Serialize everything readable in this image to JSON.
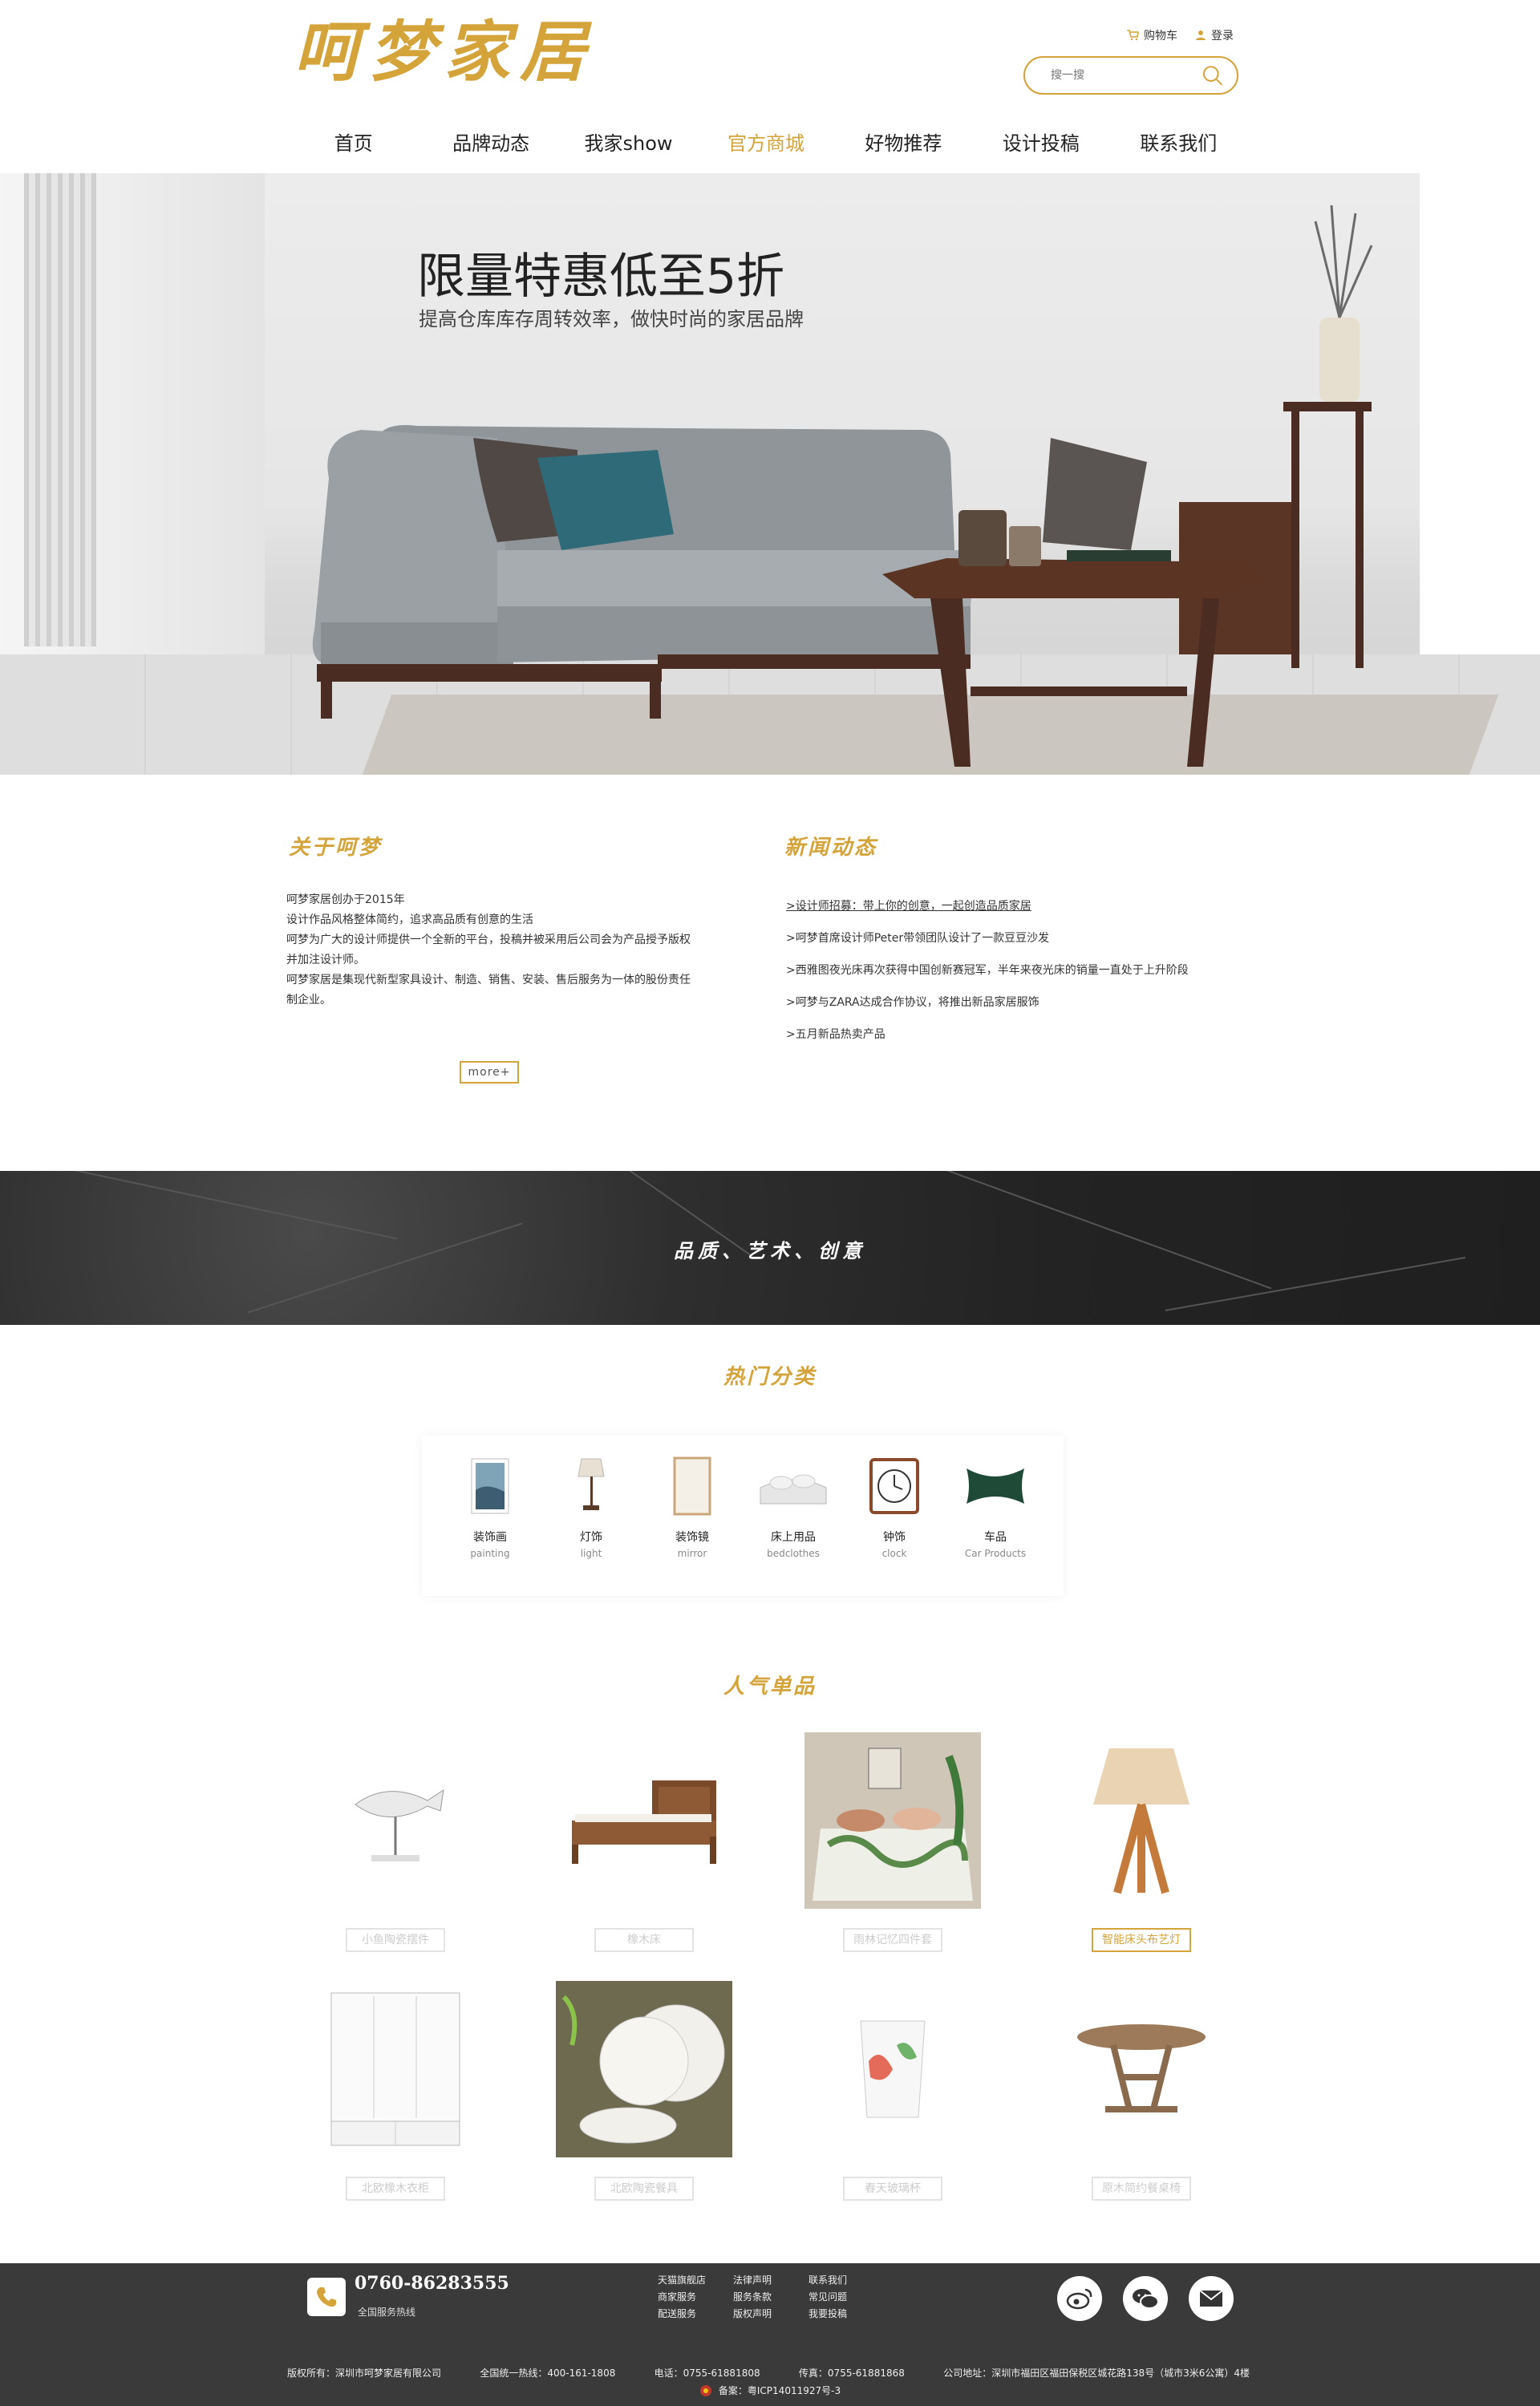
{
  "header": {
    "logo": "呵梦家居",
    "cart_label": "购物车",
    "login_label": "登录",
    "search_placeholder": "搜一搜",
    "accent_color": "#d4a33a"
  },
  "nav": {
    "items": [
      "首页",
      "品牌动态",
      "我家show",
      "官方商城",
      "好物推荐",
      "设计投稿",
      "联系我们"
    ],
    "active": "官方商城"
  },
  "banner": {
    "title": "限量特惠低至5折",
    "subtitle": "提高仓库库存周转效率，做快时尚的家居品牌"
  },
  "about": {
    "title": "关于呵梦",
    "lines": [
      "呵梦家居创办于2015年",
      "设计作品风格整体简约，追求高品质有创意的生活",
      "呵梦为广大的设计师提供一个全新的平台，投稿并被采用后公司会为产品授予版权",
      "并加注设计师。",
      "呵梦家居是集现代新型家具设计、制造、销售、安装、售后服务为一体的股份责任",
      "制企业。"
    ],
    "more": "more+"
  },
  "news": {
    "title": "新闻动态",
    "items": [
      ">设计师招募：带上你的创意，一起创造品质家居",
      ">呵梦首席设计师Peter带领团队设计了一款豆豆沙发",
      ">西雅图夜光床再次获得中国创新赛冠军，半年来夜光床的销量一直处于上升阶段",
      ">呵梦与ZARA达成合作协议，将推出新品家居服饰",
      ">五月新品热卖产品"
    ]
  },
  "band": {
    "text": "品质、艺术、创意"
  },
  "categories": {
    "title": "热门分类",
    "items": [
      {
        "zh": "装饰画",
        "en": "painting",
        "icon": "painting-icon"
      },
      {
        "zh": "灯饰",
        "en": "light",
        "icon": "lamp-icon"
      },
      {
        "zh": "装饰镜",
        "en": "mirror",
        "icon": "mirror-icon"
      },
      {
        "zh": "床上用品",
        "en": "bedclothes",
        "icon": "bedding-icon"
      },
      {
        "zh": "钟饰",
        "en": "clock",
        "icon": "clock-icon"
      },
      {
        "zh": "车品",
        "en": "Car Products",
        "icon": "car-pillow-icon"
      }
    ]
  },
  "products": {
    "title": "人气单品",
    "items": [
      {
        "name": "小鱼陶瓷摆件",
        "icon": "fish-ornament-icon"
      },
      {
        "name": "橡木床",
        "icon": "oak-bed-icon"
      },
      {
        "name": "雨林记忆四件套",
        "icon": "bedding-set-icon"
      },
      {
        "name": "智能床头布艺灯",
        "icon": "table-lamp-icon",
        "active": true
      },
      {
        "name": "北欧橡木衣柜",
        "icon": "wardrobe-icon"
      },
      {
        "name": "北欧陶瓷餐具",
        "icon": "tableware-icon"
      },
      {
        "name": "春天玻璃杯",
        "icon": "glass-cup-icon"
      },
      {
        "name": "原木简约餐桌椅",
        "icon": "dining-table-icon"
      }
    ]
  },
  "footer": {
    "phone": "0760-86283555",
    "phone_sub": "全国服务热线",
    "links": [
      "天猫旗舰店",
      "法律声明",
      "联系我们",
      "商家服务",
      "服务条款",
      "常见问题",
      "配送服务",
      "版权声明",
      "我要投稿"
    ],
    "copyright": "版权所有：深圳市呵梦家居有限公司",
    "hotline": "全国统一热线：400-161-1808",
    "tel": "电话：0755-61881808",
    "fax": "传真：0755-61881868",
    "address": "公司地址：深圳市福田区福田保税区城花路138号（城市3米6公寓）4楼",
    "icp": "备案：粤ICP14011927号-3",
    "social": [
      "weibo-icon",
      "wechat-icon",
      "mail-icon"
    ]
  }
}
